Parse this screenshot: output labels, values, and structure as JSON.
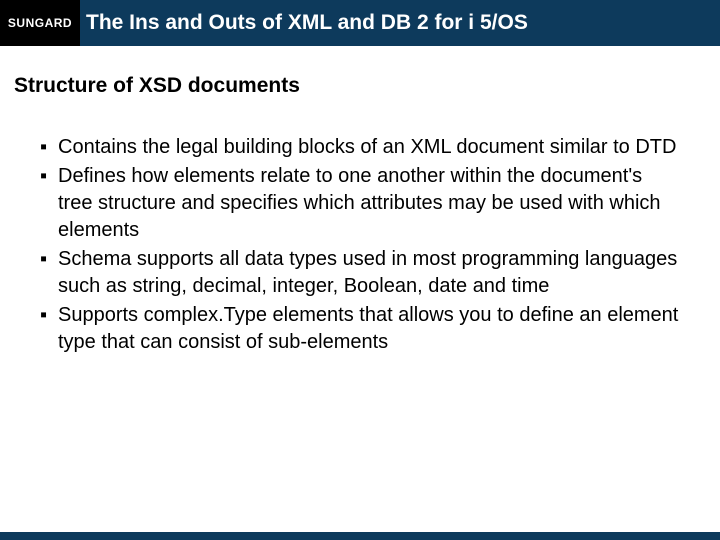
{
  "header": {
    "logo": "SUNGARD",
    "title": "The Ins and Outs of XML and DB 2 for i 5/OS"
  },
  "subtitle": "Structure of XSD documents",
  "bullets": [
    "Contains the legal building blocks of an XML document similar to DTD",
    "Defines how elements relate to one another within the document's tree structure and specifies which attributes may be used with which elements",
    "Schema supports all data types used in most programming languages such as string, decimal, integer, Boolean, date and time",
    "Supports complex.Type elements that allows you to define an element type that can consist of sub-elements"
  ]
}
